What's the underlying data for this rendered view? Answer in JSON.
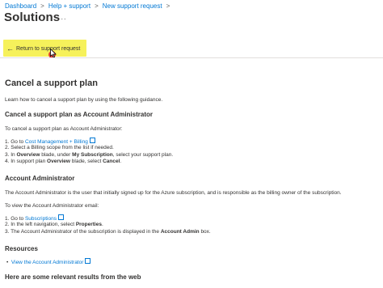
{
  "breadcrumb": {
    "items": [
      "Dashboard",
      "Help + support",
      "New support request"
    ],
    "separator": ">"
  },
  "header": {
    "title": "Solutions",
    "more": "..."
  },
  "toolbar": {
    "return_label": "Return to support request"
  },
  "article": {
    "heading": "Cancel a support plan",
    "intro": "Learn how to cancel a support plan by using the following guidance.",
    "section1": {
      "heading": "Cancel a support plan as Account Administrator",
      "lead": "To cancel a support plan as Account Administrator:",
      "steps": [
        {
          "num": "1.",
          "pre": "Go to ",
          "link": "Cost Management + Billing",
          "post": ""
        },
        {
          "num": "2.",
          "text": "Select a Billing scope from the list if needed."
        },
        {
          "num": "3.",
          "pre": "In ",
          "b1": "Overview",
          "mid": " blade, under ",
          "b2": "My Subscription",
          "post": ", select your support plan."
        },
        {
          "num": "4.",
          "pre": "In support plan ",
          "b1": "Overview",
          "mid": " blade, select ",
          "b2": "Cancel",
          "post": "."
        }
      ]
    },
    "section2": {
      "heading": "Account Administrator",
      "para": "The Account Administrator is the user that initially signed up for the Azure subscription, and is responsible as the billing owner of the subscription.",
      "lead": "To view the Account Administrator email:",
      "steps": [
        {
          "num": "1.",
          "pre": "Go to ",
          "link": "Subscriptions",
          "post": ""
        },
        {
          "num": "2.",
          "pre": "In the left navigation, select ",
          "b1": "Properties",
          "post": "."
        },
        {
          "num": "3.",
          "pre": "The Account Administrator of the subscription is displayed in the ",
          "b1": "Account Admin",
          "post": " box."
        }
      ]
    },
    "resources": {
      "heading": "Resources",
      "links": [
        "View the Account Administrator"
      ]
    },
    "web_heading": "Here are some relevant results from the web"
  },
  "colors": {
    "link": "#0078d4",
    "highlight": "#f6f15b",
    "text": "#323130"
  }
}
